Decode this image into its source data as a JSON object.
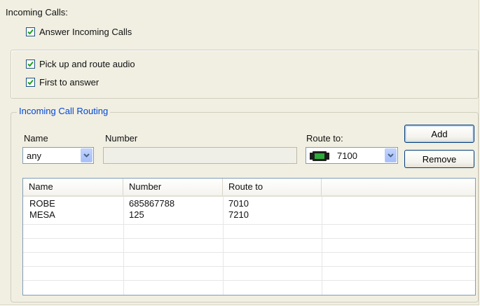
{
  "incoming_calls": {
    "heading": "Incoming Calls:",
    "answer_label": "Answer Incoming Calls",
    "answer_checked": true
  },
  "options": {
    "pickup_label": "Pick up and route audio",
    "pickup_checked": true,
    "first_label": "First to answer",
    "first_checked": true
  },
  "routing": {
    "legend": "Incoming Call Routing",
    "name_label": "Name",
    "number_label": "Number",
    "route_label": "Route to:",
    "name_value": "any",
    "number_value": "",
    "route_value": "7100",
    "route_icon": "phone-device-icon",
    "add_label": "Add",
    "remove_label": "Remove"
  },
  "table": {
    "columns": [
      "Name",
      "Number",
      "Route to",
      ""
    ],
    "rows": [
      [
        "ROBE",
        "685867788",
        "7010"
      ],
      [
        "MESA",
        "125",
        "7210"
      ]
    ]
  }
}
